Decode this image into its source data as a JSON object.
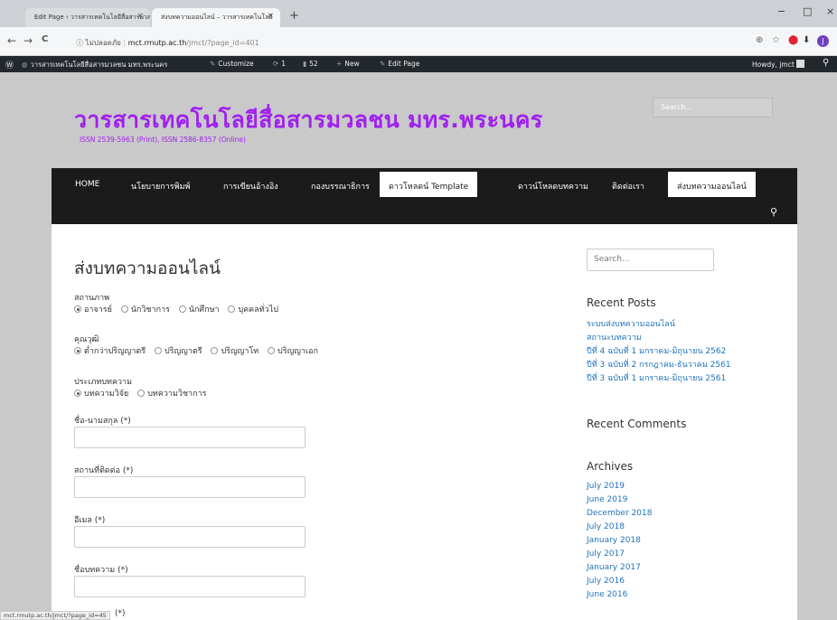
{
  "browser": {
    "tabs": [
      {
        "label": "Edit Page ‹ วารสารเทคโนโลยีสื่อสารมวลชน",
        "close": "×"
      },
      {
        "label": "ส่งบทความออนไลน์ – วารสารเทคโนโลยี",
        "close": "×"
      }
    ],
    "new_tab": "+",
    "window_controls": {
      "minimize": "−",
      "maximize": "□",
      "close": "×"
    },
    "nav": {
      "back": "←",
      "forward": "→",
      "reload": "C"
    },
    "address": {
      "security": "ⓘ ไม่ปลอดภัย",
      "host": "mct.rmutp.ac.th",
      "path": "/jmct/?page_id=401"
    }
  },
  "adminbar": {
    "site": "วารสารเทคโนโลยีสื่อสารมวลชน มทร.พระนคร",
    "customize": "Customize",
    "updates": "1",
    "comments": "52",
    "new": "New",
    "edit": "Edit Page",
    "howdy": "Howdy, jmct"
  },
  "site": {
    "title": "วารสารเทคโนโลยีสื่อสารมวลชน มทร.พระนคร",
    "issn": "ISSN 2539-5963 (Print), ISSN 2586-8357 (Online)",
    "header_search_placeholder": "Search..."
  },
  "menu": {
    "items": [
      {
        "label": "HOME"
      },
      {
        "label": "นโยบายการพิมพ์"
      },
      {
        "label": "การเขียนอ้างอิง"
      },
      {
        "label": "กองบรรณาธิการ"
      },
      {
        "label": "ดาวโหลดน์ Template"
      },
      {
        "label": "ดาวน์โหลดบทความ"
      },
      {
        "label": "ติดต่อเรา"
      },
      {
        "label": "ส่งบทความออนไลน์"
      }
    ]
  },
  "form": {
    "page_title": "ส่งบทความออนไลน์",
    "status_label": "สถานภาพ",
    "status_options": [
      "อาจารย์",
      "นักวิชาการ",
      "นักศึกษา",
      "บุคคลทั่วไป"
    ],
    "degree_label": "คุณวุฒิ",
    "degree_options": [
      "ต่ำกว่าปริญญาตรี",
      "ปริญญาตรี",
      "ปริญญาโท",
      "ปริญญาเอก"
    ],
    "type_label": "ประเภทบทความ",
    "type_options": [
      "บทความวิจัย",
      "บทความวิชาการ"
    ],
    "name_label": "ชื่อ-นามสกุล (*)",
    "address_label": "สถานที่ติดต่อ (*)",
    "email_label": "อีเมล (*)",
    "article_label": "ชื่อบทความ (*)",
    "next_label": "(*)"
  },
  "sidebar": {
    "search_placeholder": "Search...",
    "recent_posts_title": "Recent Posts",
    "recent_posts": [
      "ระบบส่งบทความออนไลน์",
      "สถานะบทความ",
      "ปีที่ 4 ฉบับที่ 1 มกราคม-มิถุนายน 2562",
      "ปีที่ 3 ฉบับที่ 2 กรกฎาคม-ธันวาคม 2561",
      "ปีที่ 3 ฉบับที่ 1 มกราคม-มิถุนายน 2561"
    ],
    "recent_comments_title": "Recent Comments",
    "archives_title": "Archives",
    "archives": [
      "July 2019",
      "June 2019",
      "December 2018",
      "July 2018",
      "January 2018",
      "July 2017",
      "January 2017",
      "July 2016",
      "June 2016"
    ]
  },
  "statusbar": {
    "url": "mct.rmutp.ac.th/jmct/?page_id=45"
  },
  "colors": {
    "accent": "#a020f0",
    "menu_bg": "#1b1b1b",
    "link": "#1e73be",
    "adminbar": "#23282d"
  }
}
